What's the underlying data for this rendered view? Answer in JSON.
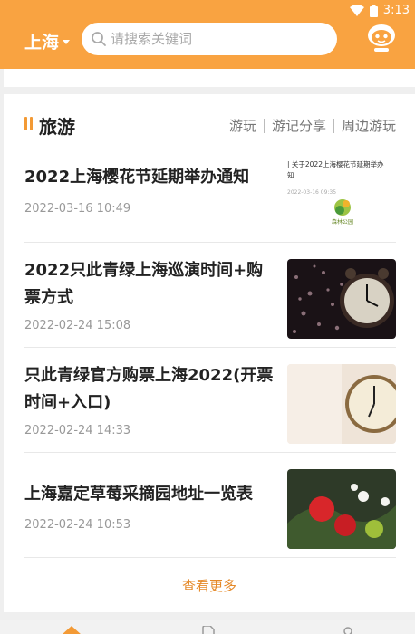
{
  "status_bar": {
    "time": "3:13"
  },
  "header": {
    "city": "上海",
    "search_placeholder": "请搜索关键词"
  },
  "section": {
    "title": "旅游",
    "links": [
      "游玩",
      "游记分享",
      "周边游玩"
    ]
  },
  "articles": [
    {
      "title": "2022上海樱花节延期举办通知",
      "date": "2022-03-16 10:49",
      "thumb_text": "| 关于2022上海樱花节延期举办",
      "thumb_text2": "知",
      "thumb_date": "2022-03-16 09:35",
      "thumb_logo": "森林公园"
    },
    {
      "title": "2022只此青绿上海巡演时间+购票方式",
      "date": "2022-02-24 15:08"
    },
    {
      "title": "只此青绿官方购票上海2022(开票时间+入口)",
      "date": "2022-02-24 14:33"
    },
    {
      "title": "上海嘉定草莓采摘园地址一览表",
      "date": "2022-02-24 10:53"
    }
  ],
  "more_label": "查看更多",
  "colors": {
    "accent": "#f9a341",
    "link_orange": "#e58a2a"
  }
}
